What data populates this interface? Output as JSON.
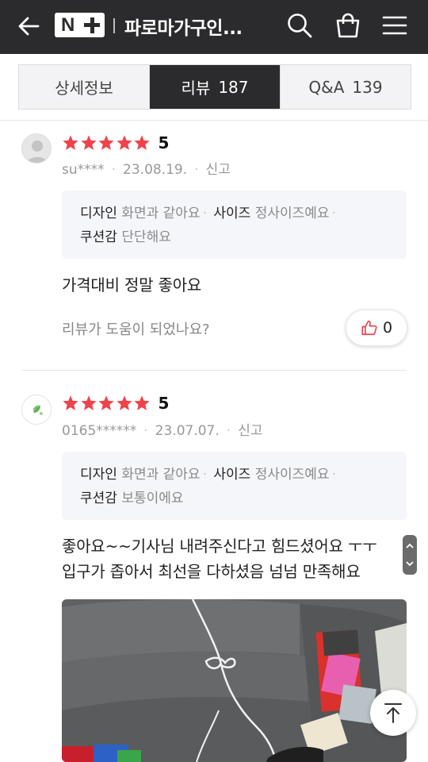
{
  "header": {
    "title": "파로마가구인...",
    "logo_letter": "N",
    "back_icon": "arrow-left-icon",
    "search_icon": "search-icon",
    "cart_icon": "shopping-bag-icon",
    "menu_icon": "hamburger-menu-icon"
  },
  "tabs": [
    {
      "label": "상세정보",
      "count": ""
    },
    {
      "label": "리뷰",
      "count": "187"
    },
    {
      "label": "Q&A",
      "count": "139"
    }
  ],
  "reviews": [
    {
      "rating": "5",
      "stars": 5,
      "user": "su****",
      "date": "23.08.19.",
      "report": "신고",
      "attrs": {
        "design_key": "디자인",
        "design_val": "화면과 같아요",
        "size_key": "사이즈",
        "size_val": "정사이즈예요",
        "cushion_key": "쿠션감",
        "cushion_val": "단단해요"
      },
      "text_lines": [
        "가격대비 정말 좋아요"
      ],
      "helpful_question": "리뷰가 도움이 되었나요?",
      "like_count": "0"
    },
    {
      "rating": "5",
      "stars": 5,
      "user": "0165******",
      "date": "23.07.07.",
      "report": "신고",
      "attrs": {
        "design_key": "디자인",
        "design_val": "화면과 같아요",
        "size_key": "사이즈",
        "size_val": "정사이즈예요",
        "cushion_key": "쿠션감",
        "cushion_val": "보통이에요"
      },
      "text_lines": [
        "좋아요~~기사님 내려주신다고 힘드셨어요 ㅜㅜ",
        "입구가 좁아서 최선을 다하셨음 넘넘 만족해요"
      ]
    }
  ],
  "colors": {
    "header_bg": "#2b2b2d",
    "star": "#f0424a",
    "like_icon": "#f0424a"
  }
}
